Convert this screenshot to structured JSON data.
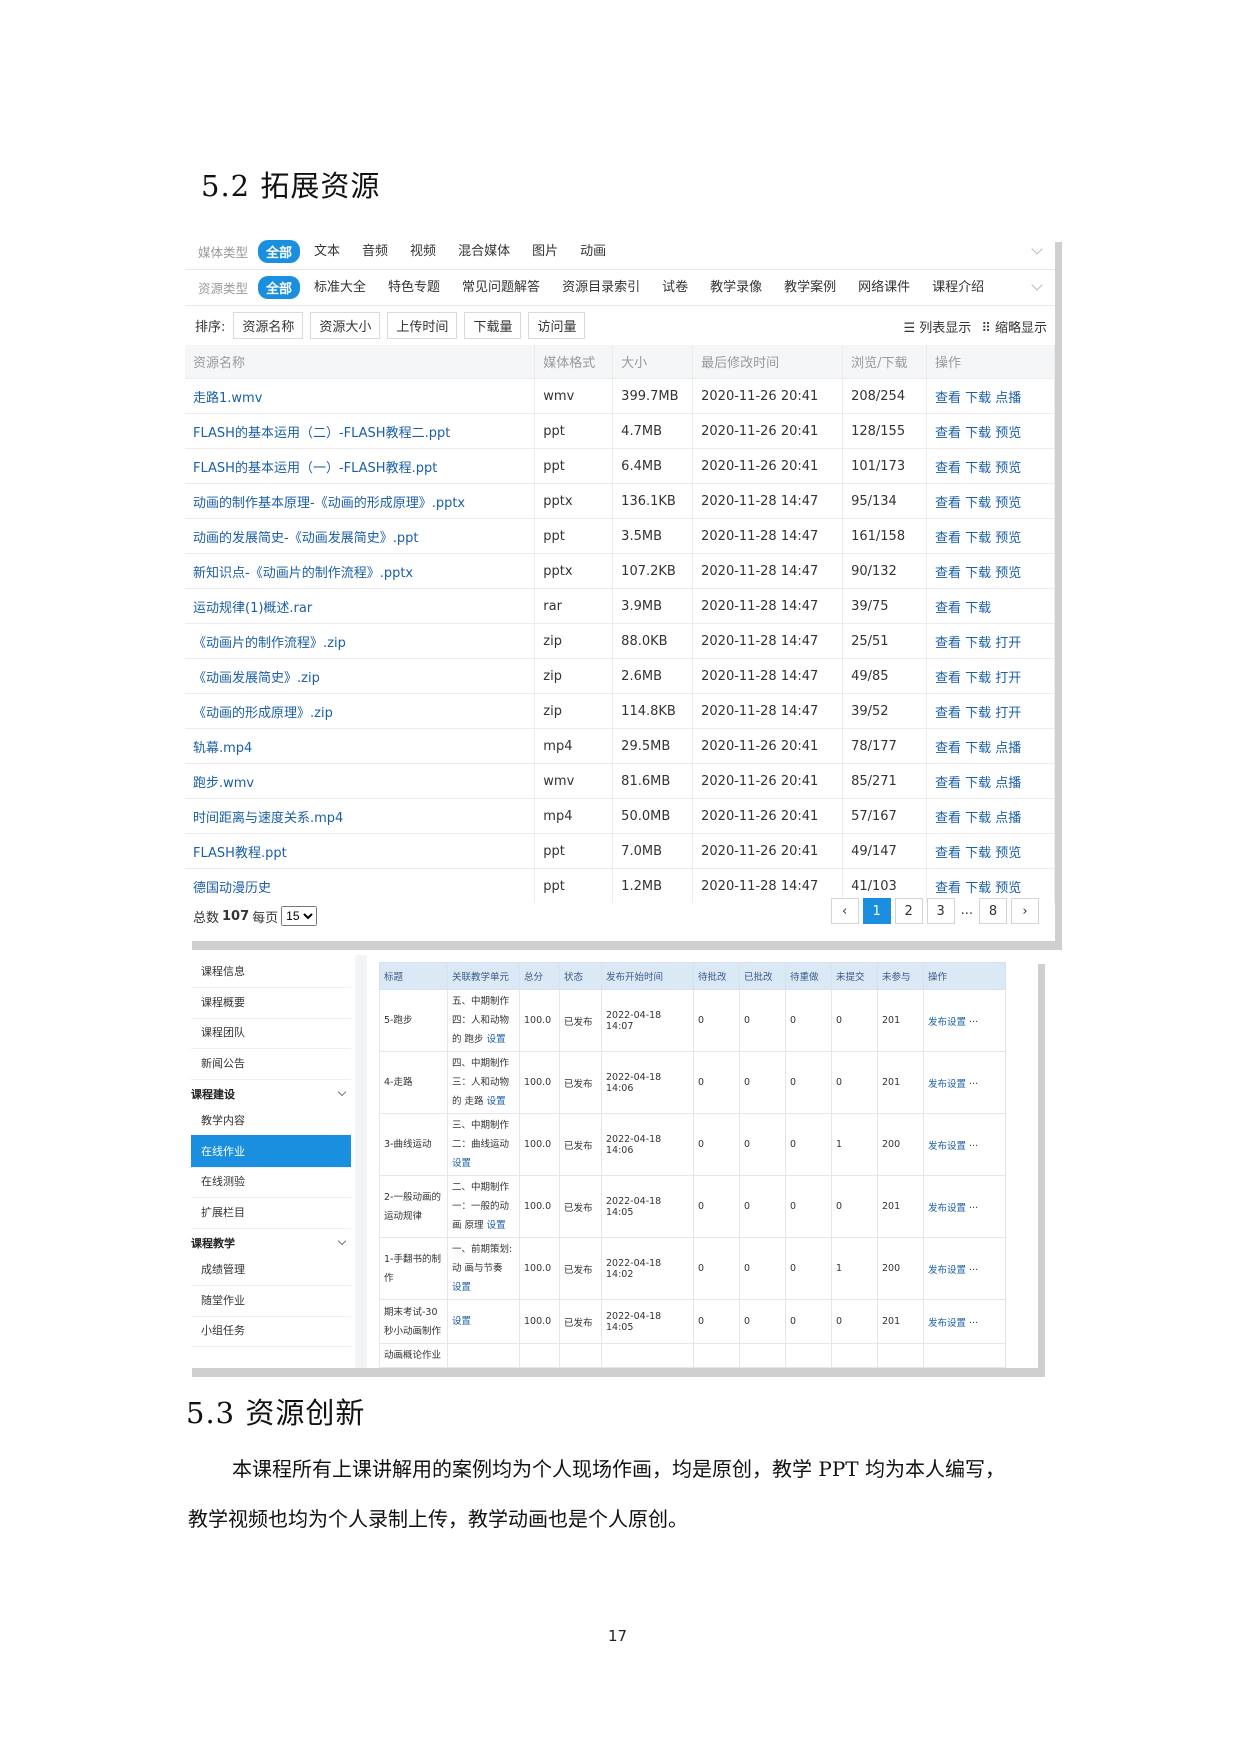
{
  "section1_title": "5.2 拓展资源",
  "section2_title": "5.3 资源创新",
  "paragraph_line1": "本课程所有上课讲解用的案例均为个人现场作画，均是原创，教学 PPT 均为本人编写，",
  "paragraph_line2": "教学视频也均为个人录制上传，教学动画也是个人原创。",
  "page_number": "17",
  "resources": {
    "media_type_label": "媒体类型",
    "media_types": [
      "全部",
      "文本",
      "音频",
      "视频",
      "混合媒体",
      "图片",
      "动画"
    ],
    "resource_type_label": "资源类型",
    "resource_types": [
      "全部",
      "标准大全",
      "特色专题",
      "常见问题解答",
      "资源目录索引",
      "试卷",
      "教学录像",
      "教学案例",
      "网络课件",
      "课程介绍"
    ],
    "sort_label": "排序:",
    "sort_buttons": [
      "资源名称",
      "资源大小",
      "上传时间",
      "下载量",
      "访问量"
    ],
    "view_list": "列表显示",
    "view_thumb": "缩略显示",
    "columns": [
      "资源名称",
      "媒体格式",
      "大小",
      "最后修改时间",
      "浏览/下载",
      "操作"
    ],
    "rows": [
      [
        "走路1.wmv",
        "wmv",
        "399.7MB",
        "2020-11-26 20:41",
        "208/254",
        "查看 下载 点播"
      ],
      [
        "FLASH的基本运用（二）-FLASH教程二.ppt",
        "ppt",
        "4.7MB",
        "2020-11-26 20:41",
        "128/155",
        "查看 下载 预览"
      ],
      [
        "FLASH的基本运用（一）-FLASH教程.ppt",
        "ppt",
        "6.4MB",
        "2020-11-26 20:41",
        "101/173",
        "查看 下载 预览"
      ],
      [
        "动画的制作基本原理-《动画的形成原理》.pptx",
        "pptx",
        "136.1KB",
        "2020-11-28 14:47",
        "95/134",
        "查看 下载 预览"
      ],
      [
        "动画的发展简史-《动画发展简史》.ppt",
        "ppt",
        "3.5MB",
        "2020-11-28 14:47",
        "161/158",
        "查看 下载 预览"
      ],
      [
        "新知识点-《动画片的制作流程》.pptx",
        "pptx",
        "107.2KB",
        "2020-11-28 14:47",
        "90/132",
        "查看 下载 预览"
      ],
      [
        "运动规律(1)概述.rar",
        "rar",
        "3.9MB",
        "2020-11-28 14:47",
        "39/75",
        "查看 下载"
      ],
      [
        "《动画片的制作流程》.zip",
        "zip",
        "88.0KB",
        "2020-11-28 14:47",
        "25/51",
        "查看 下载 打开"
      ],
      [
        "《动画发展简史》.zip",
        "zip",
        "2.6MB",
        "2020-11-28 14:47",
        "49/85",
        "查看 下载 打开"
      ],
      [
        "《动画的形成原理》.zip",
        "zip",
        "114.8KB",
        "2020-11-28 14:47",
        "39/52",
        "查看 下载 打开"
      ],
      [
        "轨幕.mp4",
        "mp4",
        "29.5MB",
        "2020-11-26 20:41",
        "78/177",
        "查看 下载 点播"
      ],
      [
        "跑步.wmv",
        "wmv",
        "81.6MB",
        "2020-11-26 20:41",
        "85/271",
        "查看 下载 点播"
      ],
      [
        "时间距离与速度关系.mp4",
        "mp4",
        "50.0MB",
        "2020-11-26 20:41",
        "57/167",
        "查看 下载 点播"
      ],
      [
        "FLASH教程.ppt",
        "ppt",
        "7.0MB",
        "2020-11-26 20:41",
        "49/147",
        "查看 下载 预览"
      ],
      [
        "德国动漫历史",
        "ppt",
        "1.2MB",
        "2020-11-28 14:47",
        "41/103",
        "查看 下载 预览"
      ]
    ],
    "total_label": "总数",
    "total": "107",
    "per_page_label": "每页",
    "per_page": "15",
    "pages": [
      "1",
      "2",
      "3",
      "...",
      "8"
    ],
    "prev": "‹",
    "next": "›"
  },
  "homework": {
    "sidebar": [
      {
        "type": "item",
        "label": "课程信息"
      },
      {
        "type": "item",
        "label": "课程概要"
      },
      {
        "type": "item",
        "label": "课程团队"
      },
      {
        "type": "item",
        "label": "新闻公告"
      },
      {
        "type": "group",
        "label": "课程建设"
      },
      {
        "type": "item",
        "label": "教学内容"
      },
      {
        "type": "item",
        "label": "在线作业",
        "active": true
      },
      {
        "type": "item",
        "label": "在线测验"
      },
      {
        "type": "item",
        "label": "扩展栏目"
      },
      {
        "type": "group",
        "label": "课程教学"
      },
      {
        "type": "item",
        "label": "成绩管理"
      },
      {
        "type": "item",
        "label": "随堂作业"
      },
      {
        "type": "item",
        "label": "小组任务"
      }
    ],
    "columns": [
      "标题",
      "关联教学单元",
      "总分",
      "状态",
      "发布开始时间",
      "待批改",
      "已批改",
      "待重做",
      "未提交",
      "未参与",
      "操作"
    ],
    "rows": [
      {
        "title": "5-跑步",
        "unit": "五、中期制作 四：人和动物的 跑步",
        "unit_link": "设置",
        "score": "100.0",
        "status": "已发布",
        "time": "2022-04-18 14:07",
        "c1": "0",
        "c2": "0",
        "c3": "0",
        "c4": "0",
        "c5": "201",
        "op": "发布设置",
        "more": "···"
      },
      {
        "title": "4-走路",
        "unit": "四、中期制作 三：人和动物的 走路",
        "unit_link": "设置",
        "score": "100.0",
        "status": "已发布",
        "time": "2022-04-18 14:06",
        "c1": "0",
        "c2": "0",
        "c3": "0",
        "c4": "0",
        "c5": "201",
        "op": "发布设置",
        "more": "···"
      },
      {
        "title": "3-曲线运动",
        "unit": "三、中期制作 二：曲线运动",
        "unit_link": "设置",
        "score": "100.0",
        "status": "已发布",
        "time": "2022-04-18 14:06",
        "c1": "0",
        "c2": "0",
        "c3": "0",
        "c4": "1",
        "c5": "200",
        "op": "发布设置",
        "more": "···"
      },
      {
        "title": "2-一般动画的运动规律",
        "unit": "二、中期制作 一：一般的动画 原理",
        "unit_link": "设置",
        "score": "100.0",
        "status": "已发布",
        "time": "2022-04-18 14:05",
        "c1": "0",
        "c2": "0",
        "c3": "0",
        "c4": "0",
        "c5": "201",
        "op": "发布设置",
        "more": "···"
      },
      {
        "title": "1-手翻书的制作",
        "unit": "一、前期策划:动 画与节奏",
        "unit_link": "设置",
        "score": "100.0",
        "status": "已发布",
        "time": "2022-04-18 14:02",
        "c1": "0",
        "c2": "0",
        "c3": "0",
        "c4": "1",
        "c5": "200",
        "op": "发布设置",
        "more": "···"
      },
      {
        "title": "期末考试-30秒小动画制作",
        "unit": "",
        "unit_link": "设置",
        "score": "100.0",
        "status": "已发布",
        "time": "2022-04-18 14:05",
        "c1": "0",
        "c2": "0",
        "c3": "0",
        "c4": "0",
        "c5": "201",
        "op": "发布设置",
        "more": "···"
      },
      {
        "title": "动画概论作业",
        "unit": "",
        "unit_link": "",
        "score": "",
        "status": "",
        "time": "",
        "c1": "",
        "c2": "",
        "c3": "",
        "c4": "",
        "c5": "",
        "op": "",
        "more": ""
      }
    ]
  }
}
